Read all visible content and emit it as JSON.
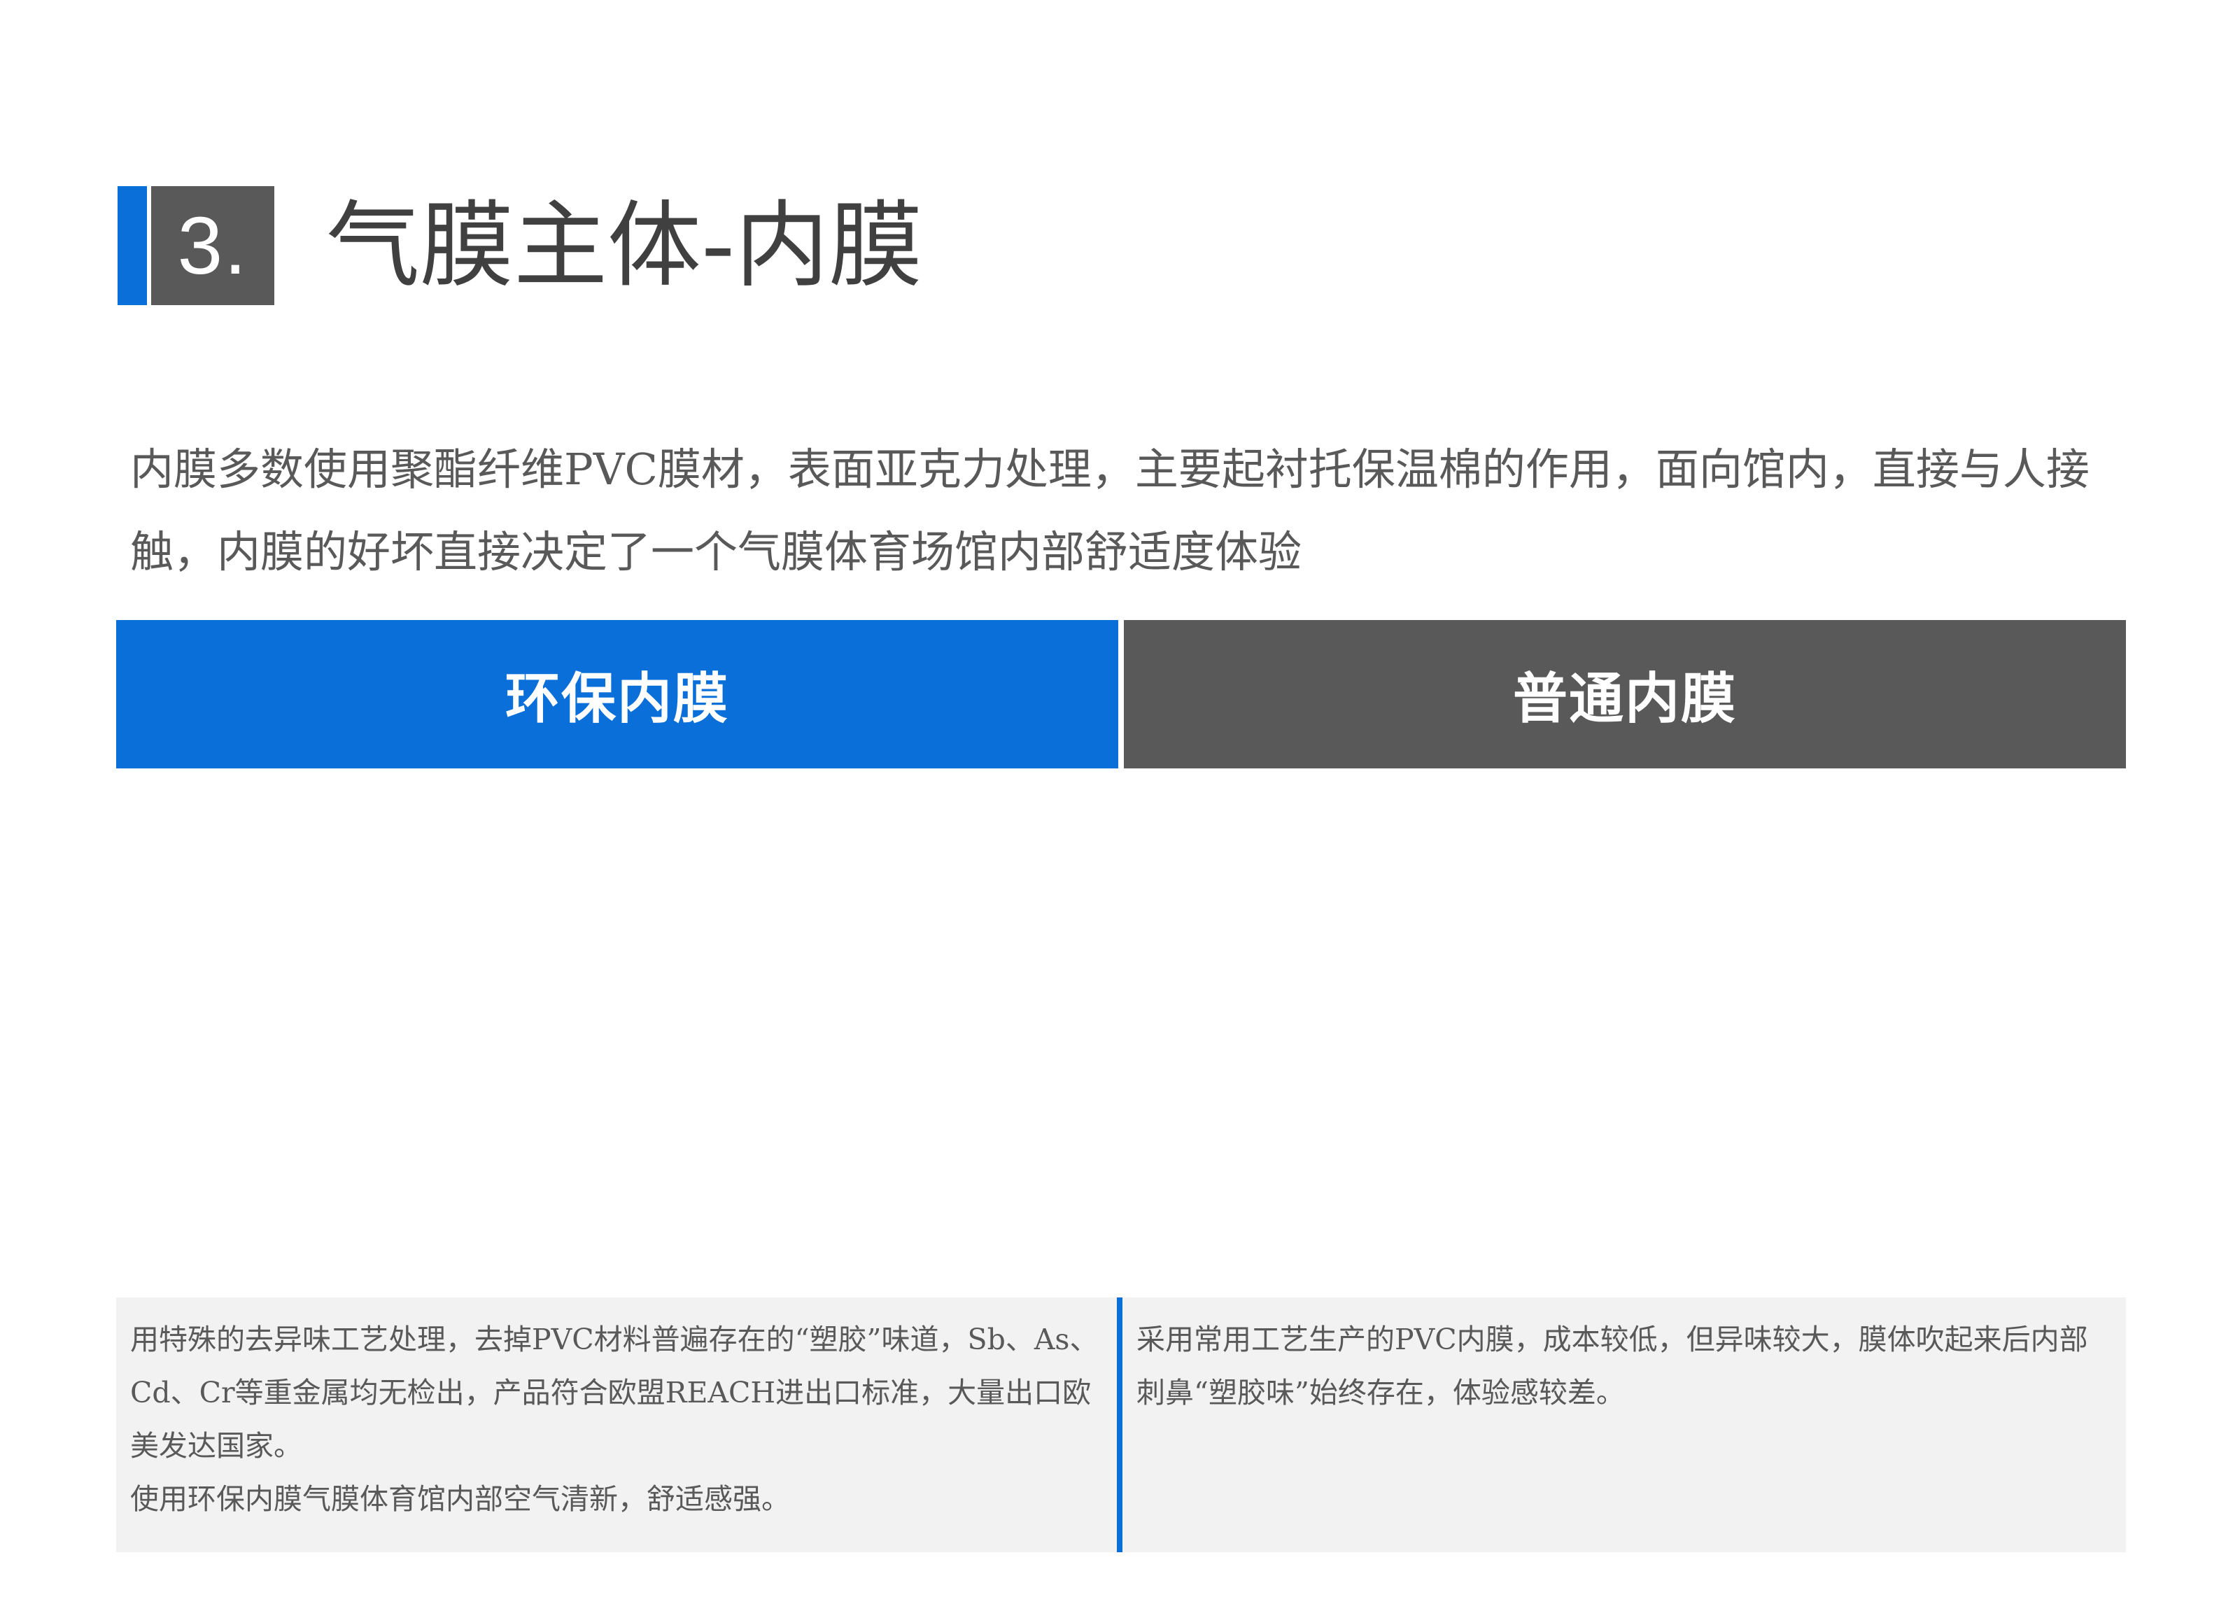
{
  "heading": {
    "number": "3.",
    "title": "气膜主体-内膜"
  },
  "intro": "内膜多数使用聚酯纤维PVC膜材，表面亚克力处理，主要起衬托保温棉的作用，面向馆内，直接与人接触，内膜的好坏直接决定了一个气膜体育场馆内部舒适度体验",
  "columns": [
    {
      "title": "环保内膜",
      "color": "#0a6fd8",
      "description": [
        "用特殊的去异味工艺处理，去掉PVC材料普遍存在的“塑胶”味道，Sb、As、Cd、Cr等重金属均无检出，产品符合欧盟REACH进出口标准，大量出口欧美发达国家。",
        "使用环保内膜气膜体育馆内部空气清新，舒适感强。"
      ]
    },
    {
      "title": "普通内膜",
      "color": "#595959",
      "description": [
        "采用常用工艺生产的PVC内膜，成本较低，但异味较大，膜体吹起来后内部刺鼻“塑胶味”始终存在，体验感较差。"
      ]
    }
  ],
  "colors": {
    "accent_blue": "#0a6fd8",
    "dark_gray": "#595959",
    "panel_gray": "#f2f2f2",
    "text_gray": "#595959"
  }
}
